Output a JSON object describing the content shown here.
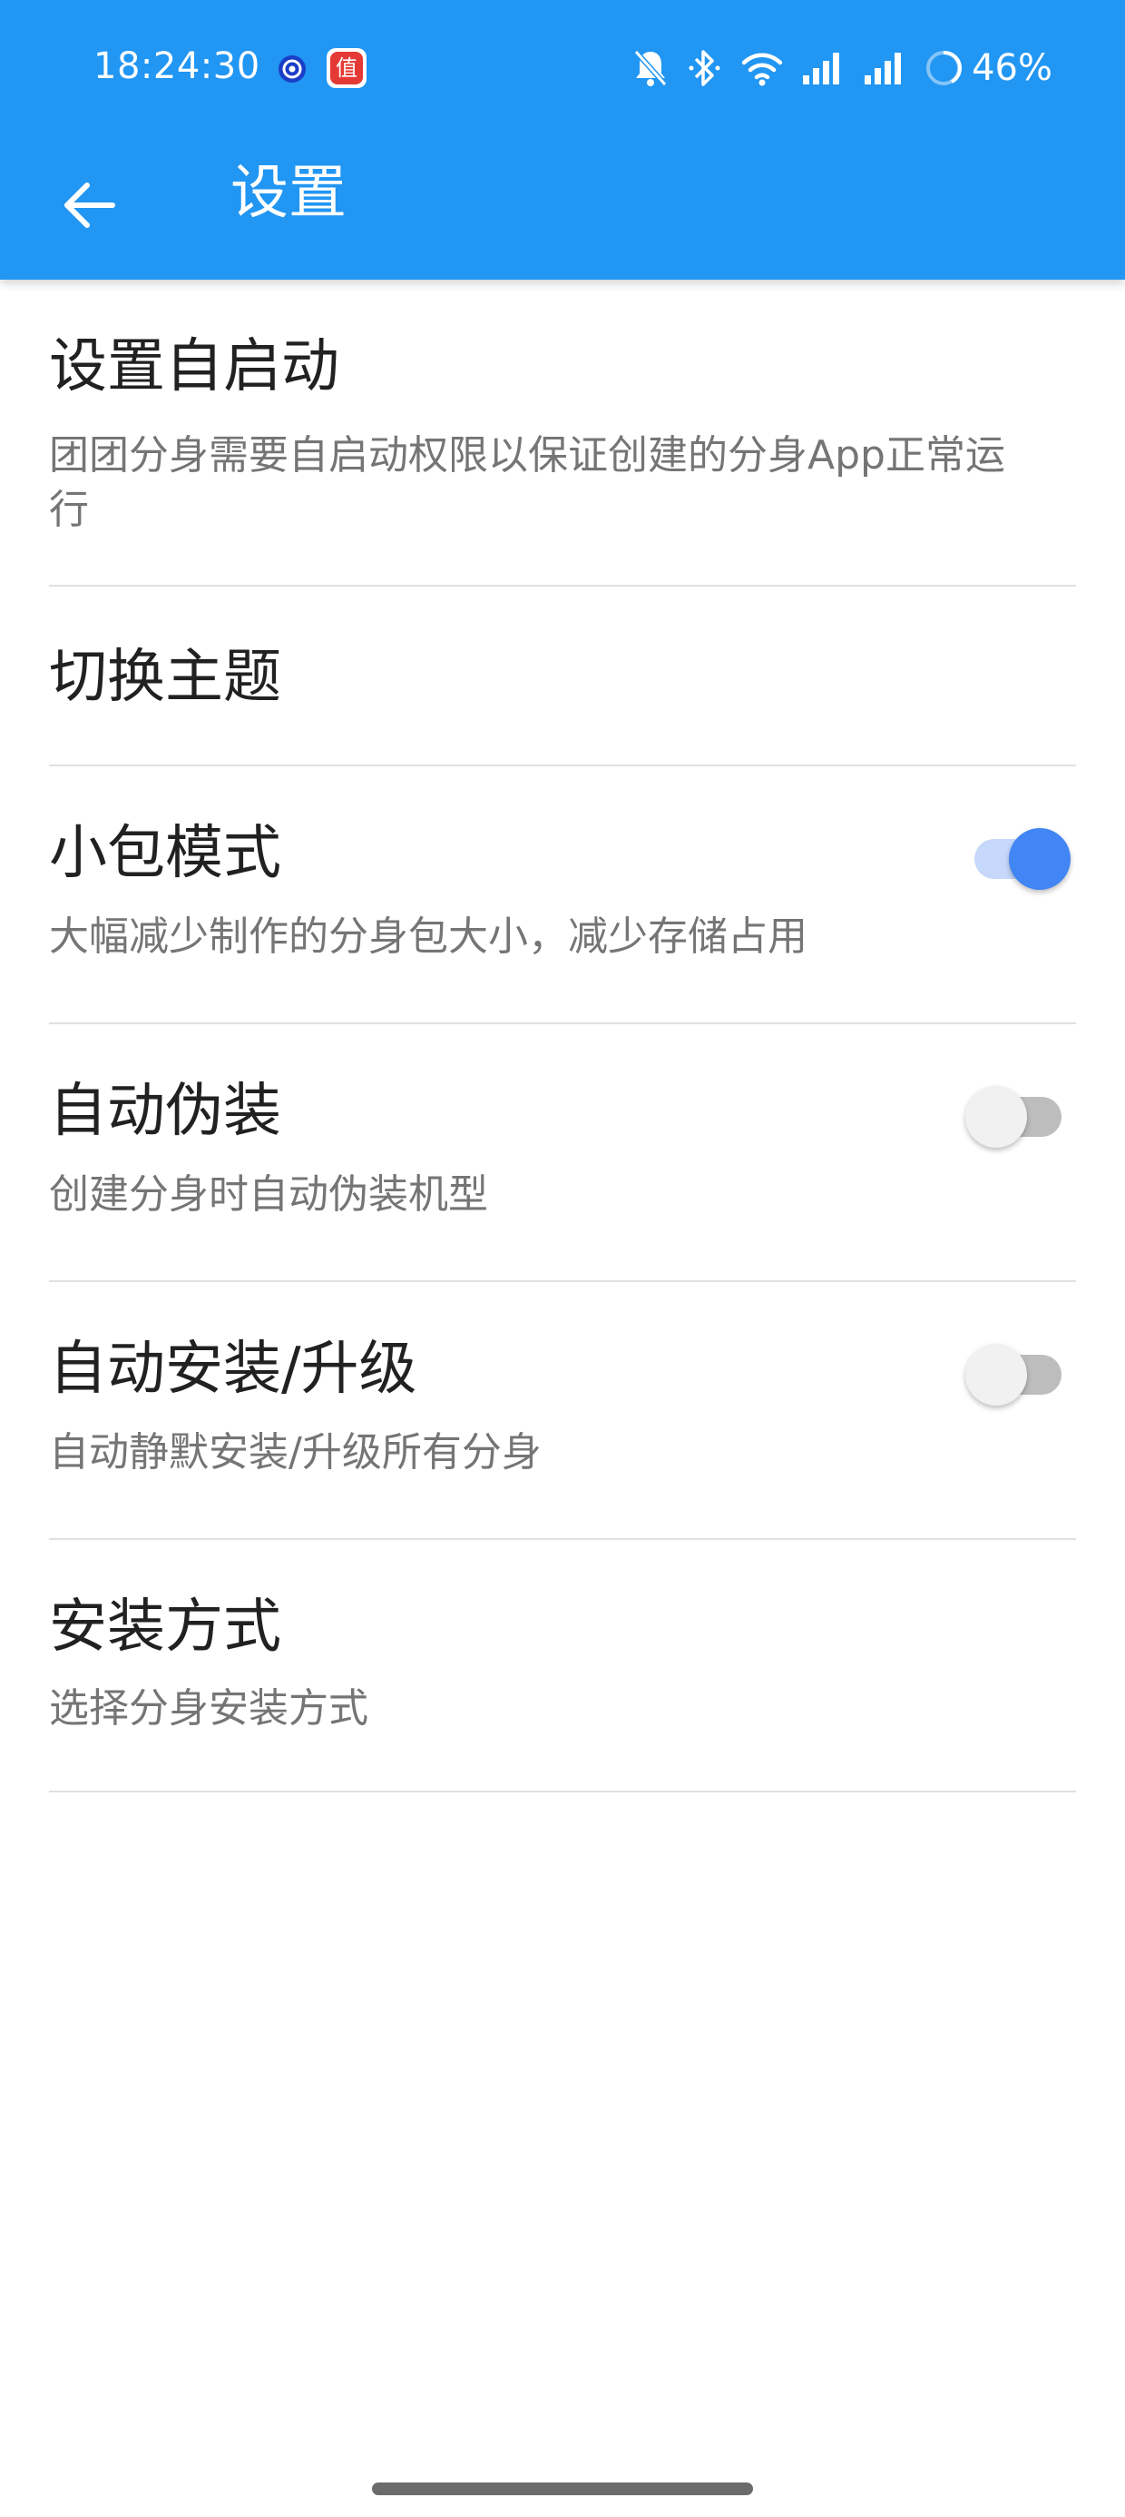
{
  "status_bar": {
    "time": "18:24:30",
    "notification_app_glyph": "值",
    "battery_percent": "46%",
    "icons": [
      "target-icon",
      "app-notification-icon",
      "bell-off-icon",
      "bluetooth-icon",
      "wifi-icon",
      "signal-icon",
      "signal-icon",
      "battery-ring-icon"
    ]
  },
  "app_bar": {
    "back_icon": "arrow-left-icon",
    "title": "设置",
    "color": "#2196F3"
  },
  "settings": {
    "items": [
      {
        "title": "设置自启动",
        "summary_line1": "团团分身需要自启动权限以保证创建的分身App正常运",
        "summary_line2": "行"
      },
      {
        "title": "切换主题"
      },
      {
        "title": "小包模式",
        "summary": "大幅减少制作的分身包大小，减少存储占用",
        "switch_on": true
      },
      {
        "title": "自动伪装",
        "summary": "创建分身时自动伪装机型",
        "switch_on": false
      },
      {
        "title": "自动安装/升级",
        "summary": "自动静默安装/升级所有分身",
        "switch_on": false
      },
      {
        "title": "安装方式",
        "summary": "选择分身安装方式"
      }
    ]
  },
  "colors": {
    "accent": "#4285F4",
    "title_text": "#212121",
    "summary_text": "#757575",
    "divider": "#e0e0e0"
  }
}
